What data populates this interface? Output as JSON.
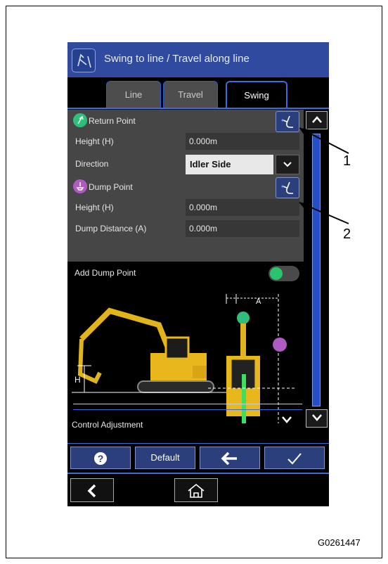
{
  "window": {
    "title": "Swing to line / Travel along line",
    "icon": "swing-line-icon"
  },
  "tabs": [
    {
      "label": "Line"
    },
    {
      "label": "Travel"
    },
    {
      "label": "Swing"
    }
  ],
  "active_tab": "Swing",
  "return_point": {
    "header": "Return Point",
    "icon": "return-point-icon",
    "height": {
      "label": "Height (H)",
      "value": "0.000m"
    },
    "direction": {
      "label": "Direction",
      "value": "Idler Side"
    }
  },
  "dump_point": {
    "header": "Dump Point",
    "icon": "dump-point-icon",
    "height": {
      "label": "Height (H)",
      "value": "0.000m"
    },
    "distance": {
      "label": "Dump Distance (A)",
      "value": "0.000m"
    }
  },
  "add_dump_point": {
    "label": "Add Dump Point",
    "toggle_on": true
  },
  "diagram": {
    "height_letter": "H",
    "distance_letter": "A"
  },
  "control_adjustment": {
    "label": "Control Adjustment"
  },
  "footer_buttons": {
    "help": "help-icon",
    "default_label": "Default",
    "back": "arrow-left-icon",
    "confirm": "checkmark-icon"
  },
  "nav": {
    "back": "chevron-left-icon",
    "home": "home-icon"
  },
  "callouts": [
    "1",
    "2"
  ],
  "figure_code": "G0261447",
  "colors": {
    "titlebar": "#2f4a9e",
    "accent": "#3e6ae0",
    "return_point": "#2fbf7a",
    "dump_point": "#b05ac4",
    "excavator": "#f0c020"
  }
}
